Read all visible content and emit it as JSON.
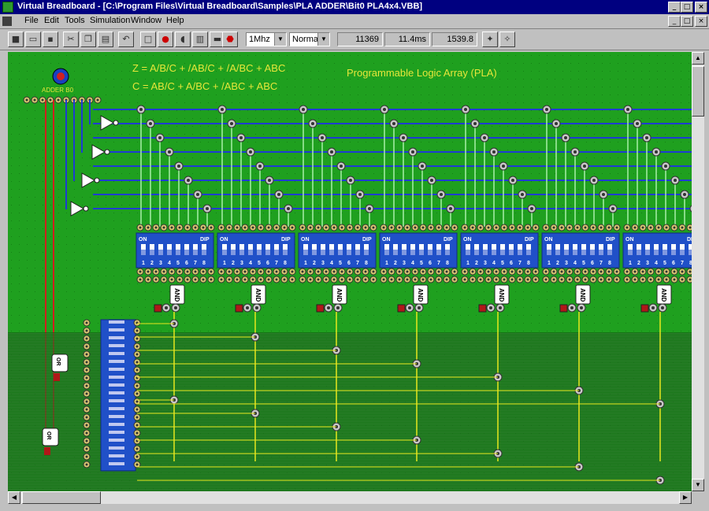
{
  "window": {
    "title": "Virtual Breadboard - [C:\\Program Files\\Virtual Breadboard\\Samples\\PLA ADDER\\Bit0 PLA4x4.VBB]",
    "min": "_",
    "max": "□",
    "close": "×"
  },
  "menu": [
    "File",
    "Edit",
    "Tools",
    "Simulation",
    "Window",
    "Help"
  ],
  "toolbar": {
    "clock": "1Mhz",
    "mode": "Normal",
    "readout1": "11369",
    "readout2": "11.4ms",
    "readout3": "1539.8",
    "icons": [
      "new-icon",
      "open-icon",
      "save-icon",
      "cut-icon",
      "copy-icon",
      "paste-icon",
      "undo-icon",
      "clear-icon",
      "stop-circle-icon",
      "probe-icon",
      "chip-icon",
      "train-icon",
      "stop-sign-icon",
      "wand-icon",
      "wand2-icon"
    ]
  },
  "canvas": {
    "formula_z": "Z = A/B/C + /AB/C + /A/BC + ABC",
    "formula_c": "C = AB/C + A/BC + /ABC + ABC",
    "heading": "Programmable Logic Array (PLA)",
    "adder_label": "ADDER B0",
    "dip_on": "ON",
    "dip_dip": "DIP",
    "dip_numbers": [
      "1",
      "2",
      "3",
      "4",
      "5",
      "6",
      "7",
      "8"
    ],
    "and_label": "AND",
    "or_label": "OR",
    "blocks": 7
  },
  "colors": {
    "board": "#1fa01f",
    "bus_blue": "#1e3cd2",
    "wire_yellow": "#e8e81e",
    "wire_red": "#d21e1e",
    "dip_blue": "#2050c8"
  }
}
